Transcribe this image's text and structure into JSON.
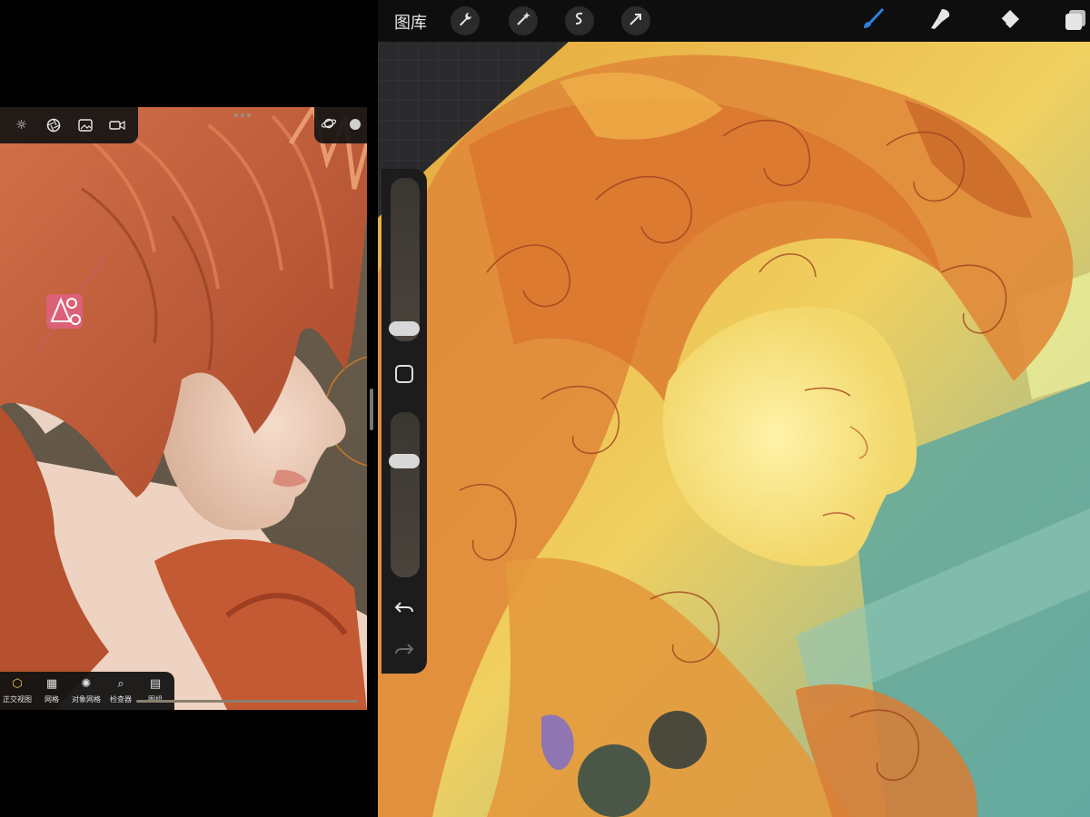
{
  "left_app": {
    "top_toolbar_icons": [
      "sun-icon",
      "aperture-icon",
      "image-icon",
      "video-icon"
    ],
    "top_right_icons": [
      "orbit-icon",
      "sphere-icon"
    ],
    "bottom_bar": [
      {
        "icon": "cube-icon",
        "label": "正交视图",
        "active": true
      },
      {
        "icon": "grid-icon",
        "label": "网格",
        "active": false
      },
      {
        "icon": "object-grid-icon",
        "label": "对象网格",
        "active": false
      },
      {
        "icon": "inspector-icon",
        "label": "检查器",
        "active": false
      },
      {
        "icon": "layers-icon",
        "label": "图组",
        "active": false
      }
    ]
  },
  "right_app": {
    "gallery_label": "图库",
    "left_actions": [
      "wrench-icon",
      "magic-wand-icon",
      "selection-icon",
      "arrow-icon"
    ],
    "right_tools": [
      "brush-icon",
      "smudge-icon",
      "eraser-icon",
      "layers-icon"
    ],
    "accent": "#2f7fe0"
  }
}
